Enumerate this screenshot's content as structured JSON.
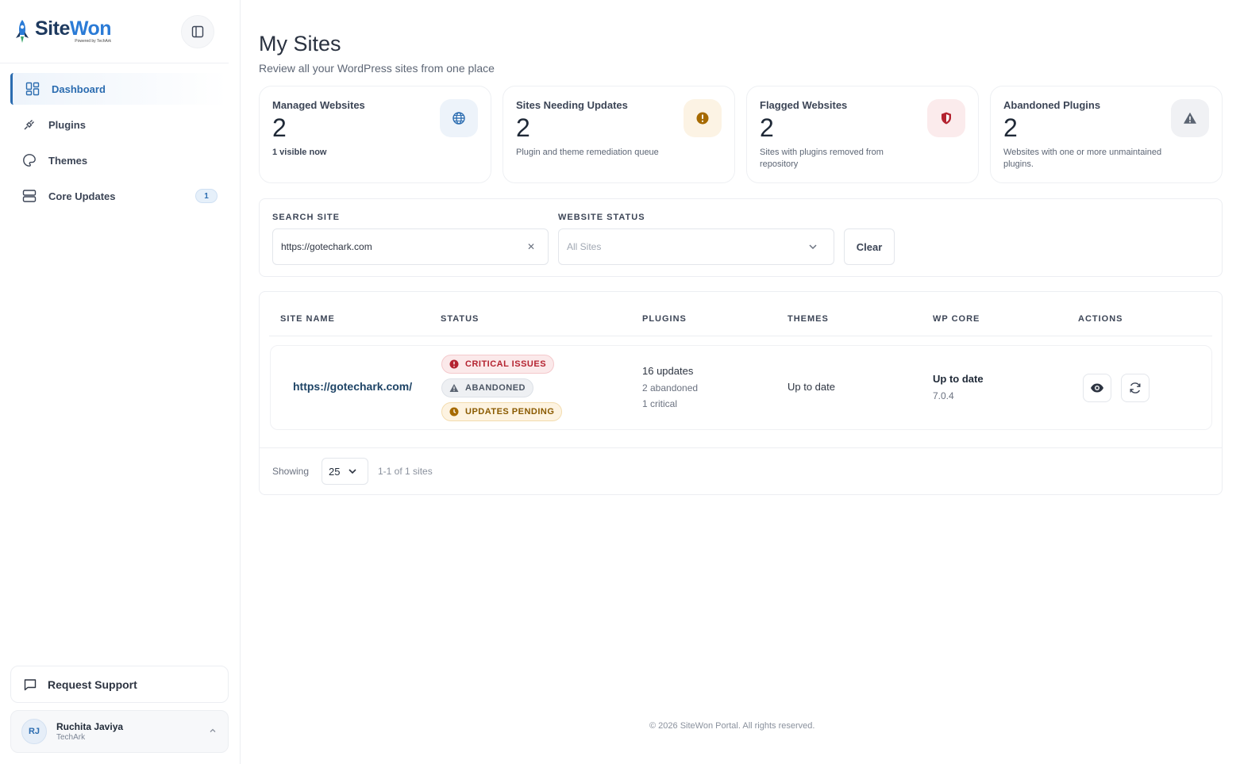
{
  "brand": {
    "name_part1": "Site",
    "name_part2": "Won",
    "tagline": "Powered by TechArk"
  },
  "sidebar": {
    "items": [
      {
        "label": "Dashboard",
        "icon": "dashboard-icon",
        "active": true
      },
      {
        "label": "Plugins",
        "icon": "plug-icon"
      },
      {
        "label": "Themes",
        "icon": "palette-icon"
      },
      {
        "label": "Core Updates",
        "icon": "server-icon",
        "badge": "1"
      }
    ],
    "support_label": "Request Support",
    "user": {
      "initials": "RJ",
      "name": "Ruchita Javiya",
      "org": "TechArk"
    }
  },
  "page": {
    "title": "My Sites",
    "subtitle": "Review all your WordPress sites from one place"
  },
  "stats": [
    {
      "title": "Managed Websites",
      "value": "2",
      "note": "1 visible now",
      "icon": "globe-icon",
      "color": "#2b6cb0"
    },
    {
      "title": "Sites Needing Updates",
      "value": "2",
      "note": "Plugin and theme remediation queue",
      "icon": "alert-circle-icon",
      "color": "#a66a00"
    },
    {
      "title": "Flagged Websites",
      "value": "2",
      "note": "Sites with plugins removed from repository",
      "icon": "shield-icon",
      "color": "#b42330"
    },
    {
      "title": "Abandoned Plugins",
      "value": "2",
      "note": "Websites with one or more unmaintained plugins.",
      "icon": "warning-triangle-icon",
      "color": "#5b6472"
    }
  ],
  "filters": {
    "search_label": "SEARCH SITE",
    "search_value": "https://gotechark.com",
    "status_label": "WEBSITE STATUS",
    "status_placeholder": "All Sites",
    "clear_label": "Clear"
  },
  "table": {
    "headers": [
      "SITE NAME",
      "STATUS",
      "PLUGINS",
      "THEMES",
      "WP CORE",
      "ACTIONS"
    ],
    "rows": [
      {
        "site": "https://gotechark.com/",
        "statuses": [
          "CRITICAL ISSUES",
          "ABANDONED",
          "UPDATES PENDING"
        ],
        "plugins": {
          "updates": "16 updates",
          "abandoned": "2 abandoned",
          "critical": "1 critical"
        },
        "themes": "Up to date",
        "core": {
          "status": "Up to date",
          "version": "7.0.4"
        }
      }
    ],
    "footer": {
      "showing_label": "Showing",
      "page_size": "25",
      "range": "1-1 of 1 sites"
    }
  },
  "footer": {
    "copyright": "© 2026 SiteWon Portal. All rights reserved."
  },
  "colors": {
    "accent": "#2b6cb0",
    "critical": "#b42330",
    "pending": "#a66a00"
  }
}
